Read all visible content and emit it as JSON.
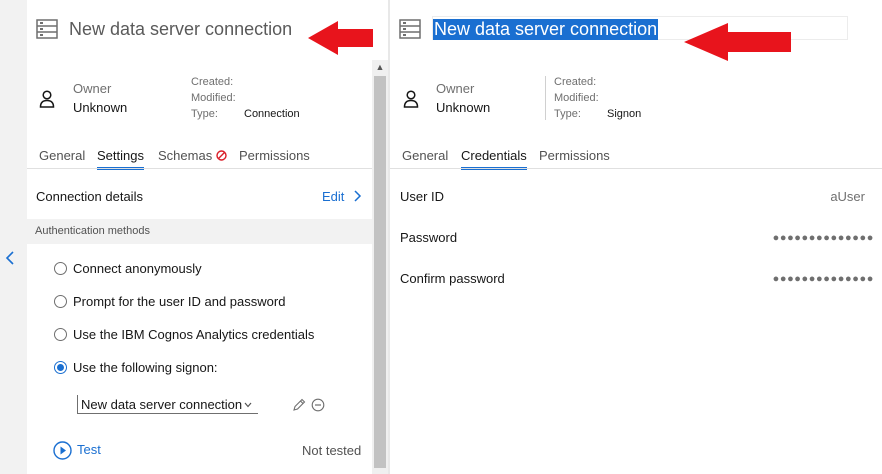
{
  "left": {
    "title": "New data server connection",
    "owner_label": "Owner",
    "owner_value": "Unknown",
    "meta": {
      "created_label": "Created:",
      "modified_label": "Modified:",
      "type_label": "Type:",
      "type_value": "Connection"
    },
    "tabs": [
      "General",
      "Settings",
      "Schemas",
      "Permissions"
    ],
    "connection_details_label": "Connection details",
    "edit_label": "Edit",
    "auth_section_label": "Authentication methods",
    "auth_options": [
      "Connect anonymously",
      "Prompt for the user ID and password",
      "Use the IBM Cognos Analytics credentials",
      "Use the following signon:"
    ],
    "selected_auth_option": "Use the following signon:",
    "signon_selected": "New data server connection",
    "test_label": "Test",
    "test_status": "Not tested"
  },
  "right": {
    "title": "New data server connection",
    "owner_label": "Owner",
    "owner_value": "Unknown",
    "meta": {
      "created_label": "Created:",
      "modified_label": "Modified:",
      "type_label": "Type:",
      "type_value": "Signon"
    },
    "tabs": [
      "General",
      "Credentials",
      "Permissions"
    ],
    "fields": [
      {
        "label": "User ID",
        "value": "aUser"
      },
      {
        "label": "Password",
        "value": "●●●●●●●●●●●●●●"
      },
      {
        "label": "Confirm password",
        "value": "●●●●●●●●●●●●●●"
      }
    ]
  },
  "colors": {
    "accent": "#1a6fd1",
    "annotation_arrow": "#e8141c",
    "schemas_error": "#da1e28"
  }
}
